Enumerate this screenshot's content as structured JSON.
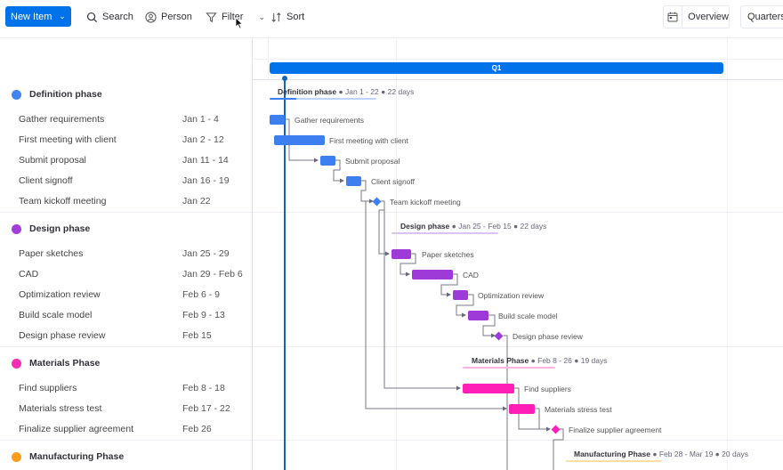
{
  "toolbar": {
    "new_item_label": "New Item",
    "search_label": "Search",
    "person_label": "Person",
    "filter_label": "Filter",
    "sort_label": "Sort",
    "overview_label": "Overview",
    "quarters_label": "Quarters"
  },
  "timeline": {
    "quarter_label": "Q1"
  },
  "colors": {
    "primary": "#0073ea",
    "definition": "#3d7ff0",
    "design": "#9d3ad8",
    "materials": "#ff1fb7",
    "manufacturing": "#ff9f1a"
  },
  "groups": [
    {
      "name": "Definition phase",
      "color": "#4384f5",
      "summary_name": "Definition phase",
      "summary_dates": "Jan 1 - 22",
      "summary_days": "22 days",
      "tasks": [
        {
          "name": "Gather requirements",
          "dates": "Jan 1 - 4"
        },
        {
          "name": "First meeting with client",
          "dates": "Jan 2 - 12"
        },
        {
          "name": "Submit proposal",
          "dates": "Jan 11 - 14"
        },
        {
          "name": "Client signoff",
          "dates": "Jan 16 - 19"
        },
        {
          "name": "Team kickoff meeting",
          "dates": "Jan 22"
        }
      ]
    },
    {
      "name": "Design phase",
      "color": "#a23ddb",
      "summary_name": "Design phase",
      "summary_dates": "Jan 25 - Feb 15",
      "summary_days": "22 days",
      "tasks": [
        {
          "name": "Paper sketches",
          "dates": "Jan 25 - 29"
        },
        {
          "name": "CAD",
          "dates": "Jan 29 - Feb 6"
        },
        {
          "name": "Optimization review",
          "dates": "Feb 6 - 9"
        },
        {
          "name": "Build scale model",
          "dates": "Feb 9 - 13"
        },
        {
          "name": "Design phase review",
          "dates": "Feb 15"
        }
      ]
    },
    {
      "name": "Materials Phase",
      "color": "#ff2bb5",
      "summary_name": "Materials Phase",
      "summary_dates": "Feb 8 - 26",
      "summary_days": "19 days",
      "tasks": [
        {
          "name": "Find suppliers",
          "dates": "Feb 8 - 18"
        },
        {
          "name": "Materials stress test",
          "dates": "Feb 17 - 22"
        },
        {
          "name": "Finalize supplier agreement",
          "dates": "Feb 26"
        }
      ]
    },
    {
      "name": "Manufacturing Phase",
      "color": "#ff9c1a",
      "summary_name": "Manufacturing Phase",
      "summary_dates": "Feb 28 - Mar 19",
      "summary_days": "20 days",
      "tasks": []
    }
  ]
}
